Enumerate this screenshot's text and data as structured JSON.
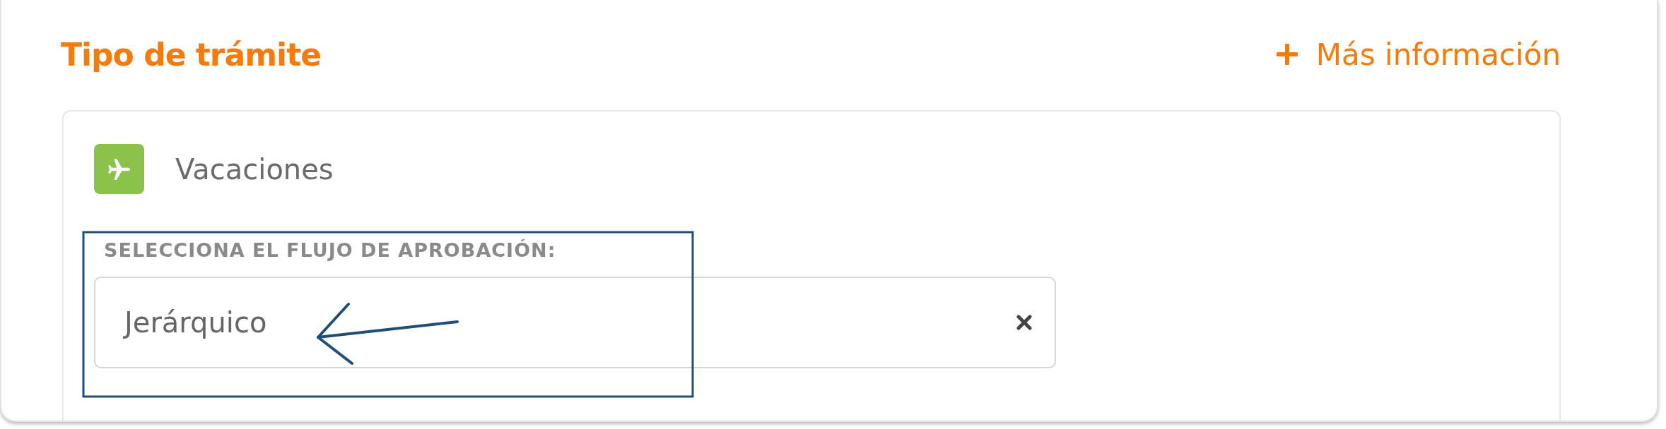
{
  "section": {
    "title": "Tipo de trámite",
    "more_info_link": "Más información"
  },
  "procedure": {
    "name": "Vacaciones"
  },
  "approval_flow": {
    "label": "SELECCIONA EL FLUJO DE APROBACIÓN:",
    "value": "Jerárquico"
  }
}
